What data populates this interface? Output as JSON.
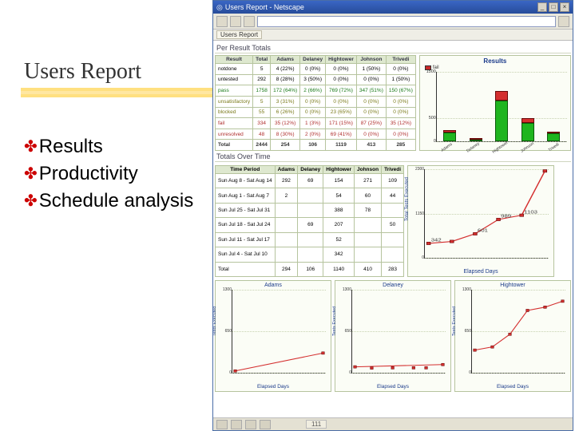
{
  "slide": {
    "title": "Users Report",
    "bullets": [
      "Results",
      "Productivity",
      "Schedule analysis"
    ]
  },
  "window": {
    "title": "Users Report - Netscape",
    "tab_label": "Users Report",
    "pager": "111"
  },
  "section1_title": "Per Result Totals",
  "section2_title": "Totals Over Time",
  "results_table": {
    "headers": [
      "Result",
      "Total",
      "Adams",
      "Delaney",
      "Hightower",
      "Johnson",
      "Trivedi"
    ],
    "rows": [
      {
        "name": "notdone",
        "cls": "",
        "cells": [
          "5",
          "4 (22%)",
          "0 (0%)",
          "0 (0%)",
          "1 (50%)",
          "0 (0%)"
        ]
      },
      {
        "name": "untested",
        "cls": "",
        "cells": [
          "292",
          "8 (28%)",
          "3 (50%)",
          "0 (0%)",
          "0 (0%)",
          "1 (50%)"
        ]
      },
      {
        "name": "pass",
        "cls": "res-green",
        "cells": [
          "1758",
          "172 (64%)",
          "2 (66%)",
          "769 (72%)",
          "347 (51%)",
          "150 (67%)"
        ]
      },
      {
        "name": "unsatisfactory",
        "cls": "res-olive",
        "cells": [
          "5",
          "3 (31%)",
          "0 (0%)",
          "0 (0%)",
          "0 (0%)",
          "0 (0%)"
        ]
      },
      {
        "name": "blocked",
        "cls": "res-olive",
        "cells": [
          "55",
          "6 (26%)",
          "0 (0%)",
          "23 (65%)",
          "0 (0%)",
          "0 (0%)"
        ]
      },
      {
        "name": "fail",
        "cls": "res-red",
        "cells": [
          "334",
          "35 (12%)",
          "1 (3%)",
          "171 (15%)",
          "87 (25%)",
          "35 (12%)"
        ]
      },
      {
        "name": "unresolved",
        "cls": "res-red",
        "cells": [
          "48",
          "8 (30%)",
          "2 (0%)",
          "69 (41%)",
          "0 (0%)",
          "0 (0%)"
        ]
      },
      {
        "name": "Total",
        "cls": "res-total",
        "cells": [
          "2444",
          "254",
          "106",
          "1119",
          "413",
          "285"
        ]
      }
    ]
  },
  "time_table": {
    "headers": [
      "Time Period",
      "Adams",
      "Delaney",
      "Hightower",
      "Johnson",
      "Trivedi"
    ],
    "rows": [
      [
        "Sun Aug 8 - Sat Aug 14",
        "292",
        "69",
        "154",
        "271",
        "109"
      ],
      [
        "Sun Aug 1 - Sat Aug 7",
        "2",
        "",
        "54",
        "60",
        "44"
      ],
      [
        "Sun Jul 25 - Sat Jul 31",
        "",
        "",
        "388",
        "78",
        ""
      ],
      [
        "Sun Jul 18 - Sat Jul 24",
        "",
        "69",
        "207",
        "",
        "50"
      ],
      [
        "Sun Jul 11 - Sat Jul 17",
        "",
        "",
        "52",
        "",
        ""
      ],
      [
        "Sun Jul 4 - Sat Jul 10",
        "",
        "",
        "342",
        "",
        ""
      ],
      [
        "Total",
        "294",
        "106",
        "1140",
        "410",
        "283"
      ]
    ]
  },
  "chart_data": [
    {
      "type": "bar",
      "title": "Results",
      "legend": [
        "fail"
      ],
      "categories": [
        "Adams",
        "Delaney",
        "Hightower",
        "Johnson",
        "Trivedi"
      ],
      "series": [
        {
          "name": "pass",
          "values": [
            172,
            2,
            769,
            347,
            150
          ]
        },
        {
          "name": "fail",
          "values": [
            35,
            1,
            171,
            87,
            35
          ]
        }
      ],
      "ylim": [
        0,
        1500
      ],
      "yticks": [
        0,
        500,
        1500
      ]
    },
    {
      "type": "line",
      "title": "",
      "xlabel": "Elapsed Days",
      "ylabel": "Total Tests Executed",
      "x": [
        7,
        14,
        21,
        28,
        35,
        42
      ],
      "values": [
        342,
        394,
        601,
        989,
        1103,
        2300
      ],
      "point_labels": [
        "342",
        "",
        "601",
        "989",
        "1103",
        "2300"
      ],
      "ylim": [
        0,
        2300
      ]
    },
    {
      "type": "line",
      "title": "Adams",
      "xlabel": "Elapsed Days",
      "ylabel": "Tests Executed",
      "x": [
        35,
        42
      ],
      "values": [
        2,
        294
      ],
      "ylim": [
        0,
        1300
      ]
    },
    {
      "type": "line",
      "title": "Delaney",
      "xlabel": "Elapsed Days",
      "ylabel": "Tests Executed",
      "x": [
        21,
        42
      ],
      "values": [
        69,
        106
      ],
      "ylim": [
        0,
        1300
      ],
      "extra_points": [
        [
          25,
          50
        ],
        [
          30,
          53
        ],
        [
          35,
          53
        ],
        [
          38,
          53
        ]
      ]
    },
    {
      "type": "line",
      "title": "Hightower",
      "xlabel": "Elapsed Days",
      "ylabel": "Tests Executed",
      "x": [
        7,
        14,
        21,
        28,
        35,
        42
      ],
      "values": [
        342,
        394,
        601,
        989,
        1043,
        1140
      ],
      "ylim": [
        0,
        1300
      ]
    }
  ]
}
